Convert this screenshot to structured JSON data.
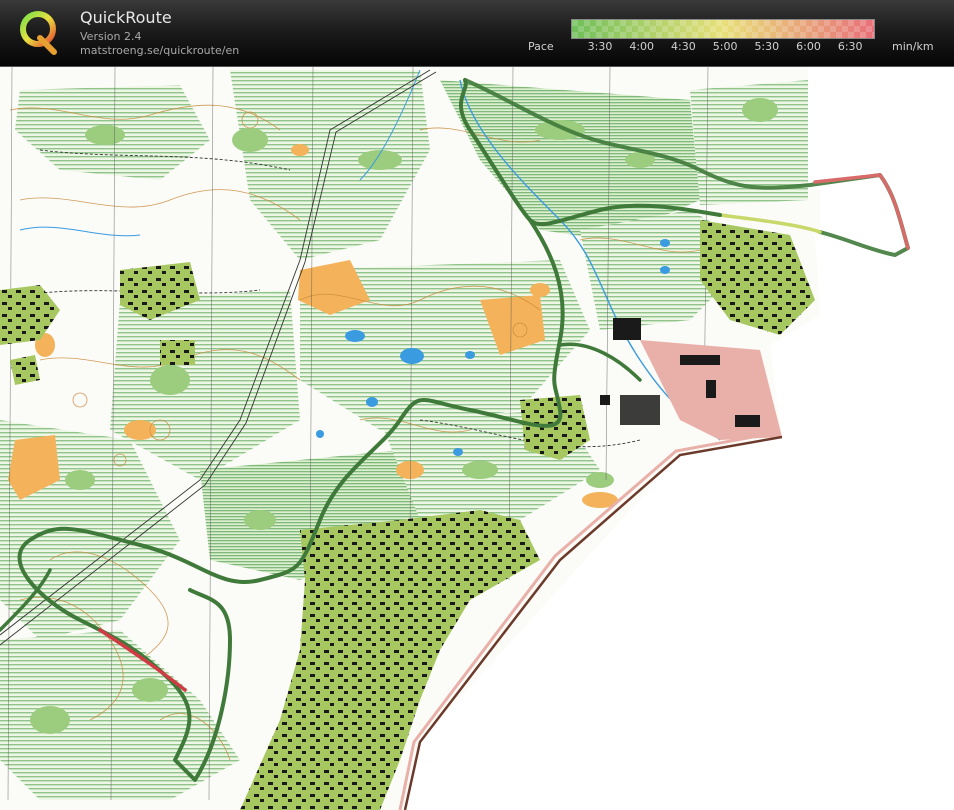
{
  "app": {
    "title": "QuickRoute",
    "version": "Version 2.4",
    "url": "matstroeng.se/quickroute/en"
  },
  "pace_legend": {
    "label": "Pace",
    "ticks": [
      "3:30",
      "4:00",
      "4:30",
      "5:00",
      "5:30",
      "6:00",
      "6:30"
    ],
    "unit": "min/km",
    "color_from": "#6fbf5a",
    "color_mid": "#e8e07a",
    "color_to": "#e8707a"
  },
  "colors": {
    "open_land": "#f4b35a",
    "forest_green": "#9ccd7e",
    "urban_green": "#a3c75a",
    "water": "#3a9be0",
    "route": "#3f7a3a",
    "slow_route": "#d23a44",
    "building": "#1a1a1a"
  },
  "icons": {
    "logo": "quickroute-q-logo"
  }
}
